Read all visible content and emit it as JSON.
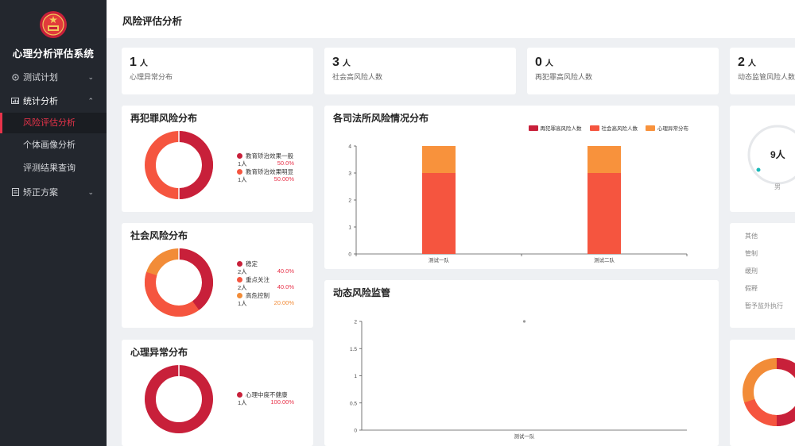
{
  "app": {
    "title": "心理分析评估系统"
  },
  "sidebar": {
    "items": [
      {
        "label": "测试计划",
        "icon": "gauge-icon"
      },
      {
        "label": "统计分析",
        "icon": "chart-icon"
      },
      {
        "label": "矫正方案",
        "icon": "document-icon"
      }
    ],
    "sub_items": [
      {
        "label": "风险评估分析",
        "active": true
      },
      {
        "label": "个体画像分析"
      },
      {
        "label": "评测结果查询"
      }
    ]
  },
  "header": {
    "title": "风险评估分析"
  },
  "stats": [
    {
      "value": "1",
      "unit": "人",
      "label": "心理异常分布"
    },
    {
      "value": "3",
      "unit": "人",
      "label": "社会高风险人数"
    },
    {
      "value": "0",
      "unit": "人",
      "label": "再犯罪高风险人数"
    },
    {
      "value": "2",
      "unit": "人",
      "label": "动态监管风险人数"
    }
  ],
  "recidivism": {
    "title": "再犯罪风险分布",
    "items": [
      {
        "label": "教育矫治效果一般",
        "count": "1人",
        "pct": "50.0%",
        "color": "#c8203a"
      },
      {
        "label": "教育矫治效果明显",
        "count": "1人",
        "pct": "50.00%",
        "color": "#f5553f"
      }
    ]
  },
  "social": {
    "title": "社会风险分布",
    "items": [
      {
        "label": "稳定",
        "count": "2人",
        "pct": "40.0%",
        "color": "#c8203a"
      },
      {
        "label": "重点关注",
        "count": "2人",
        "pct": "40.0%",
        "color": "#f5553f"
      },
      {
        "label": "高危控制",
        "count": "1人",
        "pct": "20.00%",
        "color": "#f28c38"
      }
    ]
  },
  "mental": {
    "title": "心理异常分布",
    "items": [
      {
        "label": "心理中度不健康",
        "count": "1人",
        "pct": "100.00%",
        "color": "#c8203a"
      }
    ]
  },
  "branch_chart": {
    "title": "各司法所风险情况分布",
    "legend": [
      "再犯罪高风险人数",
      "社会高风险人数",
      "心理异常分布"
    ]
  },
  "dynamic_chart": {
    "title": "动态风险监管"
  },
  "gauge": {
    "value": "9人",
    "caption": "男"
  },
  "side_list": [
    "其他",
    "管制",
    "缓刑",
    "假释",
    "暂予监外执行"
  ],
  "chart_data": [
    {
      "type": "bar",
      "title": "各司法所风险情况分布",
      "categories": [
        "测试一队",
        "测试二队"
      ],
      "series": [
        {
          "name": "再犯罪高风险人数",
          "values": [
            0,
            0
          ],
          "color": "#c8203a"
        },
        {
          "name": "社会高风险人数",
          "values": [
            3,
            3
          ],
          "color": "#f5553f"
        },
        {
          "name": "心理异常分布",
          "values": [
            1,
            1
          ],
          "color": "#f8923c"
        }
      ],
      "stacked": true,
      "ylim": [
        0,
        4
      ],
      "yticks": [
        "0",
        "1",
        "2",
        "3",
        "4"
      ]
    },
    {
      "type": "scatter",
      "title": "动态风险监管",
      "categories": [
        "测试一队"
      ],
      "values": [
        2
      ],
      "ylim": [
        0,
        2
      ],
      "yticks": [
        "0",
        "0.5",
        "1",
        "1.5",
        "2"
      ]
    }
  ]
}
